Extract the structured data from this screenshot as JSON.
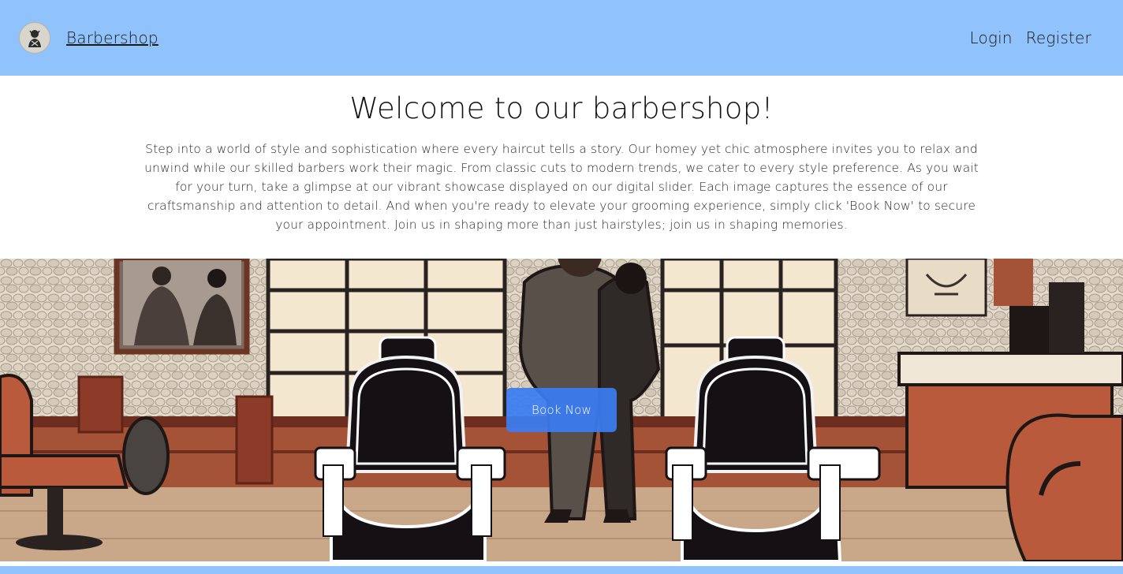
{
  "navbar": {
    "brand_label": "Barbershop",
    "links": [
      "Login",
      "Register"
    ],
    "background": "#90c2fb"
  },
  "intro": {
    "title": "Welcome to our barbershop!",
    "paragraph": "Step into a world of style and sophistication where every haircut tells a story. Our homey yet chic atmosphere invites you to relax and unwind while our skilled barbers work their magic. From classic cuts to modern trends, we cater to every style preference. As you wait for your turn, take a glimpse at our vibrant showcase displayed on our digital slider. Each image captures the essence of our craftsmanship and attention to detail. And when you're ready to elevate your grooming experience, simply click 'Book Now' to secure your appointment. Join us in shaping more than just hairstyles; join us in shaping memories."
  },
  "hero": {
    "button_label": "Book Now",
    "button_color": "#3b7df2"
  },
  "icons": {
    "logo": "barber-logo-icon"
  }
}
